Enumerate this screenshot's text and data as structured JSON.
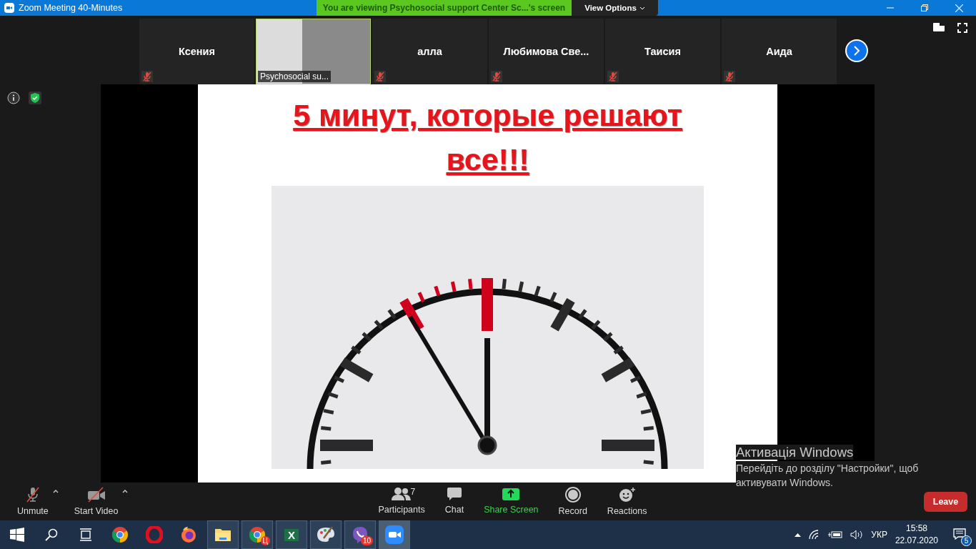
{
  "window": {
    "title": "Zoom Meeting 40-Minutes"
  },
  "banner": {
    "text": "You are viewing Psychosocial support Center Sc...'s screen",
    "view_options": "View Options"
  },
  "participants": [
    {
      "kind": "name",
      "name": "Ксения",
      "muted": true,
      "speaking": false
    },
    {
      "kind": "video",
      "name": "Psychosocial su...",
      "muted": false,
      "speaking": true
    },
    {
      "kind": "name",
      "name": "алла",
      "muted": true,
      "speaking": false
    },
    {
      "kind": "name",
      "name": "Любимова  Све...",
      "muted": true,
      "speaking": false
    },
    {
      "kind": "name",
      "name": "Таисия",
      "muted": true,
      "speaking": false
    },
    {
      "kind": "name",
      "name": "Аида",
      "muted": true,
      "speaking": false
    }
  ],
  "slide": {
    "title": "5 минут, которые решают все!!!"
  },
  "toolbar": {
    "left": [
      {
        "kind": "mic",
        "label": "Unmute"
      },
      {
        "kind": "video",
        "label": "Start Video"
      }
    ],
    "center": [
      {
        "kind": "participants",
        "label": "Participants",
        "count": "7"
      },
      {
        "kind": "chat",
        "label": "Chat"
      },
      {
        "kind": "share",
        "label": "Share Screen"
      },
      {
        "kind": "record",
        "label": "Record"
      },
      {
        "kind": "reactions",
        "label": "Reactions"
      }
    ],
    "leave": "Leave"
  },
  "activation": {
    "title": "Активація Windows",
    "text": "Перейдіть до розділу \"Настройки\", щоб активувати Windows."
  },
  "taskbar": {
    "apps": [
      {
        "kind": "start",
        "open": false
      },
      {
        "kind": "search",
        "open": false
      },
      {
        "kind": "taskview",
        "open": false
      },
      {
        "kind": "chrome",
        "open": false
      },
      {
        "kind": "opera",
        "open": false
      },
      {
        "kind": "firefox",
        "open": false
      },
      {
        "kind": "explorer",
        "open": true
      },
      {
        "kind": "chrome",
        "open": true,
        "badge": "Ц"
      },
      {
        "kind": "excel",
        "open": true,
        "glyph": "X"
      },
      {
        "kind": "paint",
        "open": true
      },
      {
        "kind": "viber",
        "open": true,
        "badge": "10"
      },
      {
        "kind": "zoom",
        "open": true,
        "selected": true
      }
    ],
    "language": "УКР",
    "time": "15:58",
    "date": "22.07.2020",
    "notifications": "5"
  }
}
